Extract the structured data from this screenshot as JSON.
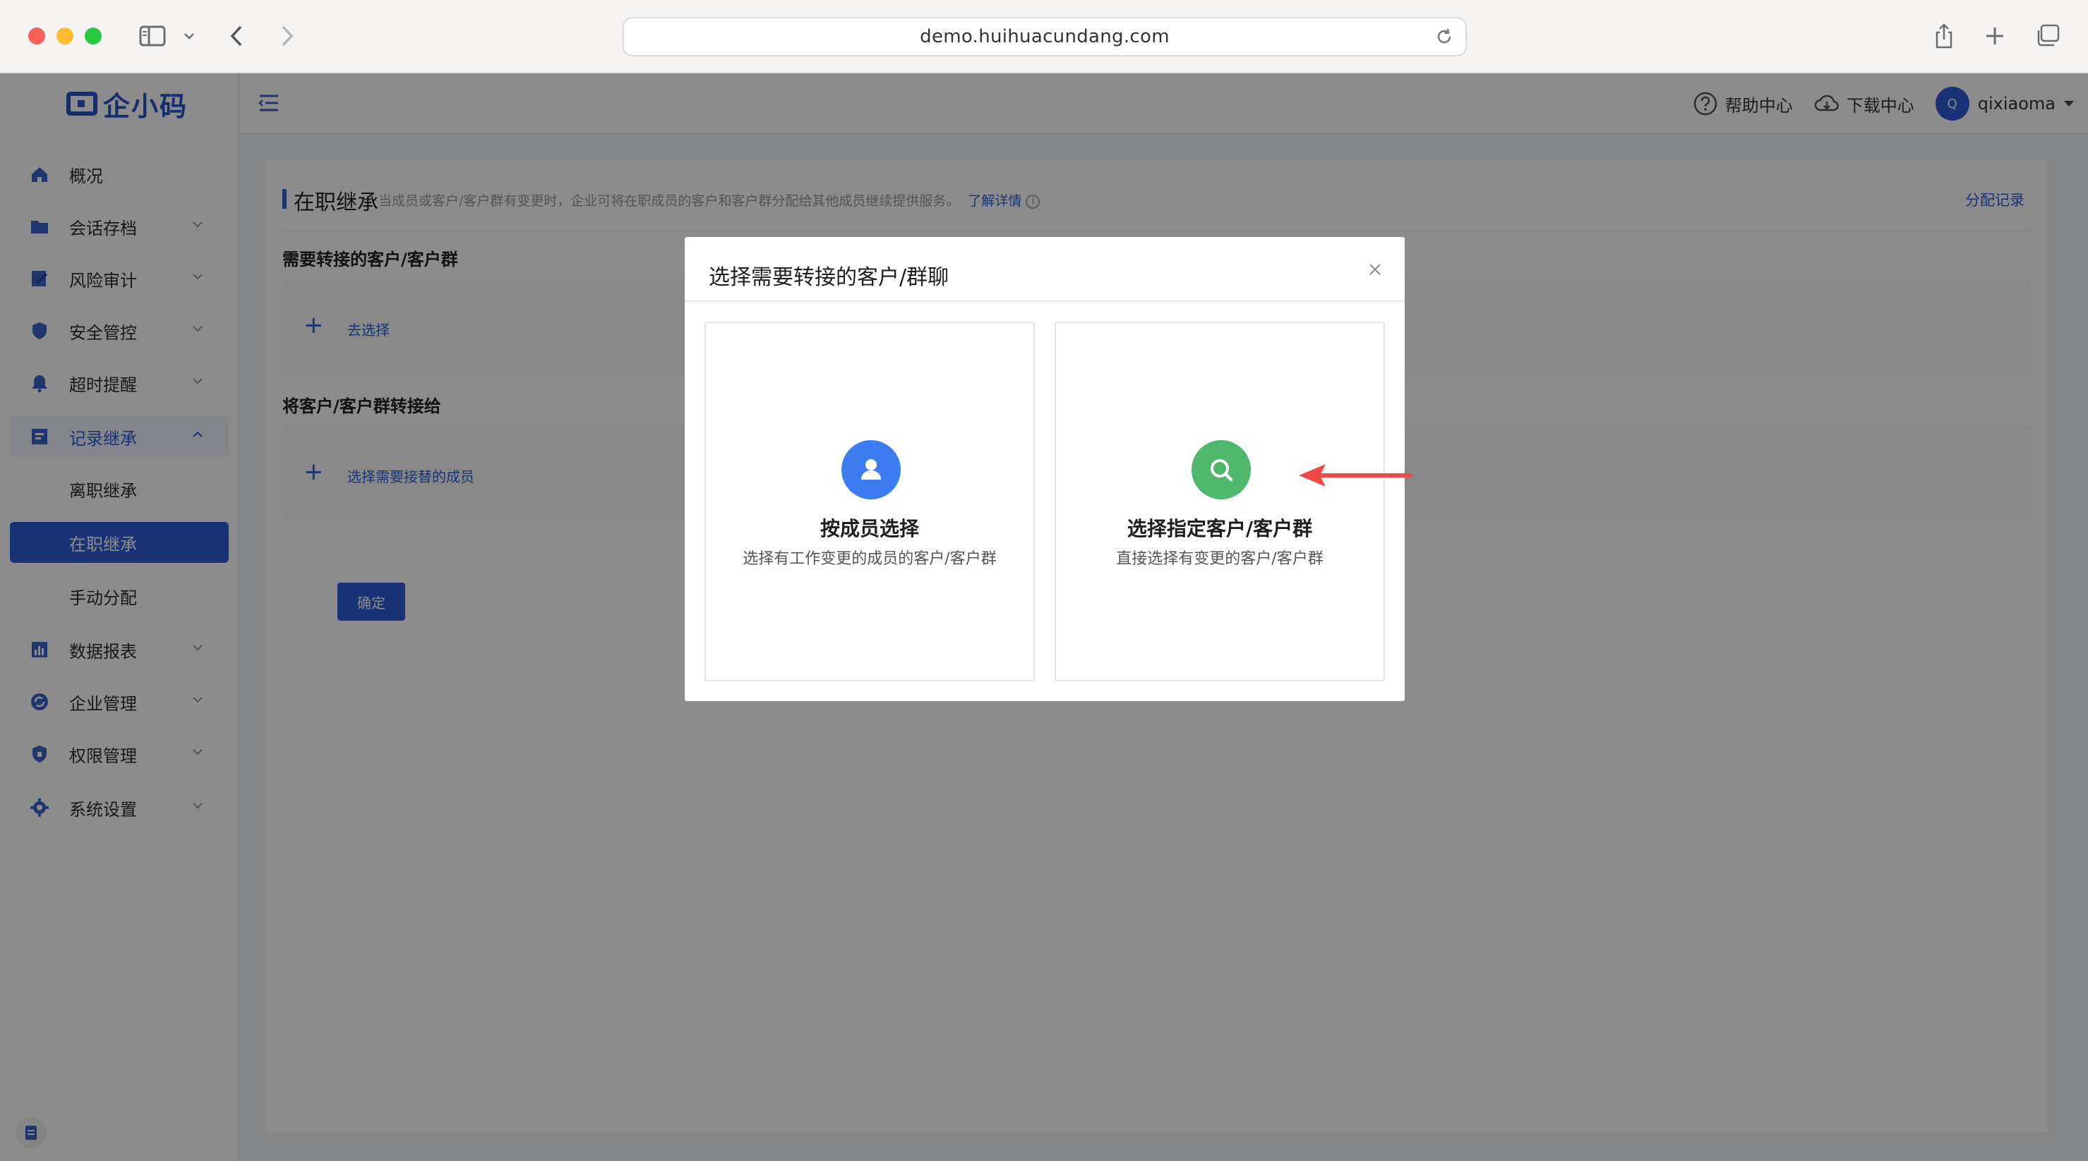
{
  "browser": {
    "url": "demo.huihuacundang.com"
  },
  "app": {
    "logo_text": "企小码",
    "menu": [
      {
        "label": "概况",
        "icon": "home-icon"
      },
      {
        "label": "会话存档",
        "icon": "folder-icon"
      },
      {
        "label": "风险审计",
        "icon": "audit-icon"
      },
      {
        "label": "安全管控",
        "icon": "shield-icon"
      },
      {
        "label": "超时提醒",
        "icon": "bell-icon"
      },
      {
        "label": "记录继承",
        "icon": "record-icon"
      },
      {
        "label": "数据报表",
        "icon": "chart-icon"
      },
      {
        "label": "企业管理",
        "icon": "sync-icon"
      },
      {
        "label": "权限管理",
        "icon": "lock-icon"
      },
      {
        "label": "系统设置",
        "icon": "gear-icon"
      }
    ],
    "submenu": [
      {
        "label": "离职继承"
      },
      {
        "label": "在职继承"
      },
      {
        "label": "手动分配"
      }
    ],
    "topbar": {
      "help": "帮助中心",
      "download": "下载中心",
      "avatar_letter": "Q",
      "user": "qixiaoma"
    },
    "page": {
      "title": "在职继承",
      "desc": "当成员或客户/客户群有变更时，企业可将在职成员的客户和客户群分配给其他成员继续提供服务。",
      "desc_link": "了解详情",
      "assign_record": "分配记录",
      "section1_label": "需要转接的客户/客户群",
      "section1_action": "去选择",
      "section2_label": "将客户/客户群转接给",
      "section2_action": "选择需要接替的成员",
      "confirm": "确定"
    }
  },
  "modal": {
    "title": "选择需要转接的客户/群聊",
    "options": [
      {
        "title": "按成员选择",
        "desc": "选择有工作变更的成员的客户/客户群",
        "icon": "user-icon",
        "color": "#3d7cf0"
      },
      {
        "title": "选择指定客户/客户群",
        "desc": "直接选择有变更的客户/客户群",
        "icon": "search-icon",
        "color": "#4fb86c"
      }
    ]
  },
  "colors": {
    "primary": "#2f5ed8",
    "annotation_arrow": "#ee4b45"
  }
}
